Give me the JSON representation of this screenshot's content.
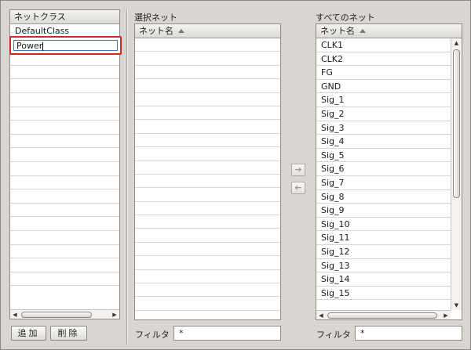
{
  "netclass": {
    "header": "ネットクラス",
    "items": [
      "DefaultClass"
    ],
    "editing_value": "Power",
    "empty_rows": 17,
    "add_label": "追加",
    "delete_label": "削除"
  },
  "selected": {
    "title": "選択ネット",
    "header": "ネット名",
    "empty_rows": 20,
    "filter_label": "フィルタ",
    "filter_value": "*"
  },
  "all": {
    "title": "すべてのネット",
    "header": "ネット名",
    "items": [
      "CLK1",
      "CLK2",
      "FG",
      "GND",
      "Sig_1",
      "Sig_2",
      "Sig_3",
      "Sig_4",
      "Sig_5",
      "Sig_6",
      "Sig_7",
      "Sig_8",
      "Sig_9",
      "Sig_10",
      "Sig_11",
      "Sig_12",
      "Sig_13",
      "Sig_14",
      "Sig_15"
    ],
    "filter_label": "フィルタ",
    "filter_value": "*"
  },
  "transfer": {
    "add_icon": "arrow-right-icon",
    "remove_icon": "arrow-left-icon"
  },
  "colors": {
    "background": "#d9d6d2",
    "highlight_border": "#d42424",
    "focus_border": "#4a78b5"
  }
}
